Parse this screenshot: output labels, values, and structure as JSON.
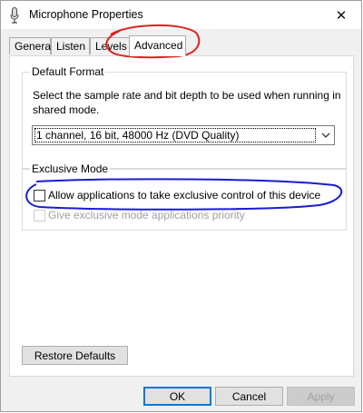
{
  "window": {
    "title": "Microphone Properties",
    "close_label": "✕"
  },
  "tabs": [
    {
      "label": "General",
      "active": false
    },
    {
      "label": "Listen",
      "active": false
    },
    {
      "label": "Levels",
      "active": false
    },
    {
      "label": "Advanced",
      "active": true
    }
  ],
  "default_format": {
    "heading": "Default Format",
    "description": "Select the sample rate and bit depth to be used when running in shared mode.",
    "selected_format": "1 channel, 16 bit, 48000 Hz (DVD Quality)"
  },
  "exclusive_mode": {
    "heading": "Exclusive Mode",
    "allow_exclusive": {
      "label": "Allow applications to take exclusive control of this device",
      "checked": false,
      "enabled": true
    },
    "give_priority": {
      "label": "Give exclusive mode applications priority",
      "checked": false,
      "enabled": false
    }
  },
  "buttons": {
    "restore_defaults": "Restore Defaults",
    "ok": "OK",
    "cancel": "Cancel",
    "apply": "Apply"
  },
  "annotations": {
    "tab_circle_color": "#e0201e",
    "checkbox_circle_color": "#1a1ad6"
  }
}
